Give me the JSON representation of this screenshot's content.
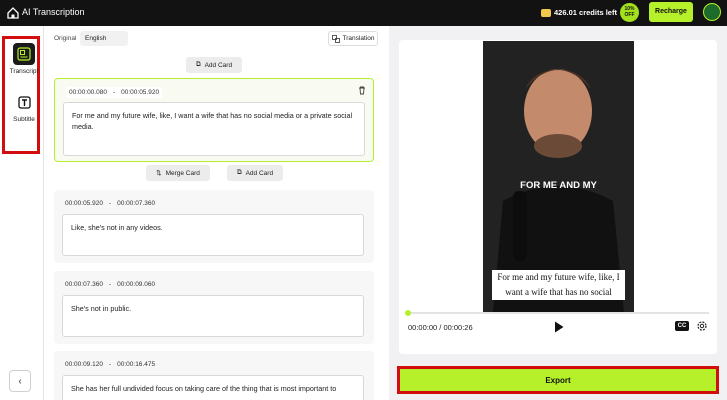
{
  "header": {
    "title": "AI Transcription",
    "credits": "426.01 credits left",
    "discount_badge": "10% OFF",
    "recharge_label": "Recharge"
  },
  "rail": {
    "items": [
      {
        "label": "Transcript",
        "icon": "transcript-icon",
        "active": true
      },
      {
        "label": "Subtitle",
        "icon": "subtitle-icon",
        "active": false
      }
    ]
  },
  "toolbar": {
    "original_label": "Original",
    "language": "English",
    "translation_label": "Translation",
    "add_card_label": "Add Card",
    "merge_card_label": "Merge Card"
  },
  "cards": [
    {
      "start": "00:00:00.080",
      "sep": "-",
      "end": "00:00:05.920",
      "text": "For me and my future wife, like, I want a wife that has no social media or a private social media."
    },
    {
      "start": "00:00:05.920",
      "sep": "-",
      "end": "00:00:07.360",
      "text": "Like, she's not in any videos."
    },
    {
      "start": "00:00:07.360",
      "sep": "-",
      "end": "00:00:09.060",
      "text": "She's not in public."
    },
    {
      "start": "00:00:09.120",
      "sep": "-",
      "end": "00:00:16.475",
      "text": "She has her full undivided focus on taking care of the thing that is most important to"
    }
  ],
  "player": {
    "overlay_caption": "FOR ME AND MY",
    "subtitle_line1": "For me and my future wife, like, I",
    "subtitle_line2": "want a wife that has no social",
    "time": "00:00:00 / 00:00:26",
    "progress": 0.0,
    "cc_label": "CC"
  },
  "export": {
    "label": "Export"
  },
  "colors": {
    "accent": "#b6f02a",
    "highlight": "#d30d0d",
    "topbar": "#121212"
  }
}
